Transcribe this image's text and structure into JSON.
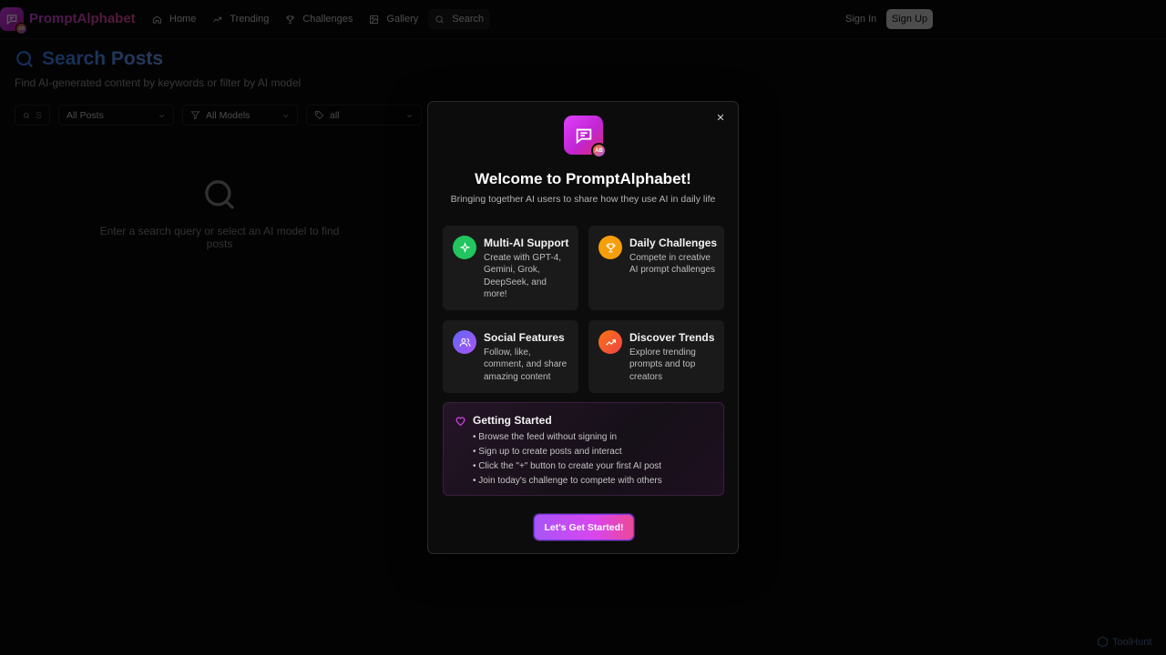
{
  "nav": {
    "brand": "PromptAlphabet",
    "logo_badge": "AB",
    "links": [
      {
        "label": "Home",
        "icon": "home-icon"
      },
      {
        "label": "Trending",
        "icon": "trending-icon"
      },
      {
        "label": "Challenges",
        "icon": "trophy-icon"
      },
      {
        "label": "Gallery",
        "icon": "image-icon"
      },
      {
        "label": "Search",
        "icon": "search-icon"
      }
    ],
    "sign_in": "Sign In",
    "sign_up": "Sign Up"
  },
  "search_page": {
    "title": "Search Posts",
    "subtitle": "Find AI-generated content by keywords or filter by AI model",
    "search_placeholder": "S",
    "filter_posts": "All Posts",
    "filter_models": "All Models",
    "filter_tag": "all",
    "empty_message": "Enter a search query or select an AI model to find posts"
  },
  "modal": {
    "logo_badge": "AB",
    "title": "Welcome to PromptAlphabet!",
    "subtitle": "Bringing together AI users to share how they use AI in daily life",
    "features": [
      {
        "title": "Multi-AI Support",
        "desc": "Create with GPT-4, Gemini, Grok, DeepSeek, and more!",
        "icon": "sparkles-icon",
        "color": "#22c55e"
      },
      {
        "title": "Daily Challenges",
        "desc": "Compete in creative AI prompt challenges",
        "icon": "trophy-icon",
        "color": "#f59e0b"
      },
      {
        "title": "Social Features",
        "desc": "Follow, like, comment, and share amazing content",
        "icon": "users-icon",
        "color": "#8b5cf6"
      },
      {
        "title": "Discover Trends",
        "desc": "Explore trending prompts and top creators",
        "icon": "trending-up-icon",
        "color": "#f97316"
      }
    ],
    "getting_started": {
      "title": "Getting Started",
      "items": [
        "• Browse the feed without signing in",
        "• Sign up to create posts and interact",
        "• Click the \"+\" button to create your first AI post",
        "• Join today's challenge to compete with others"
      ]
    },
    "cta": "Let's Get Started!",
    "close": "×"
  },
  "watermark": "ToolHunt"
}
